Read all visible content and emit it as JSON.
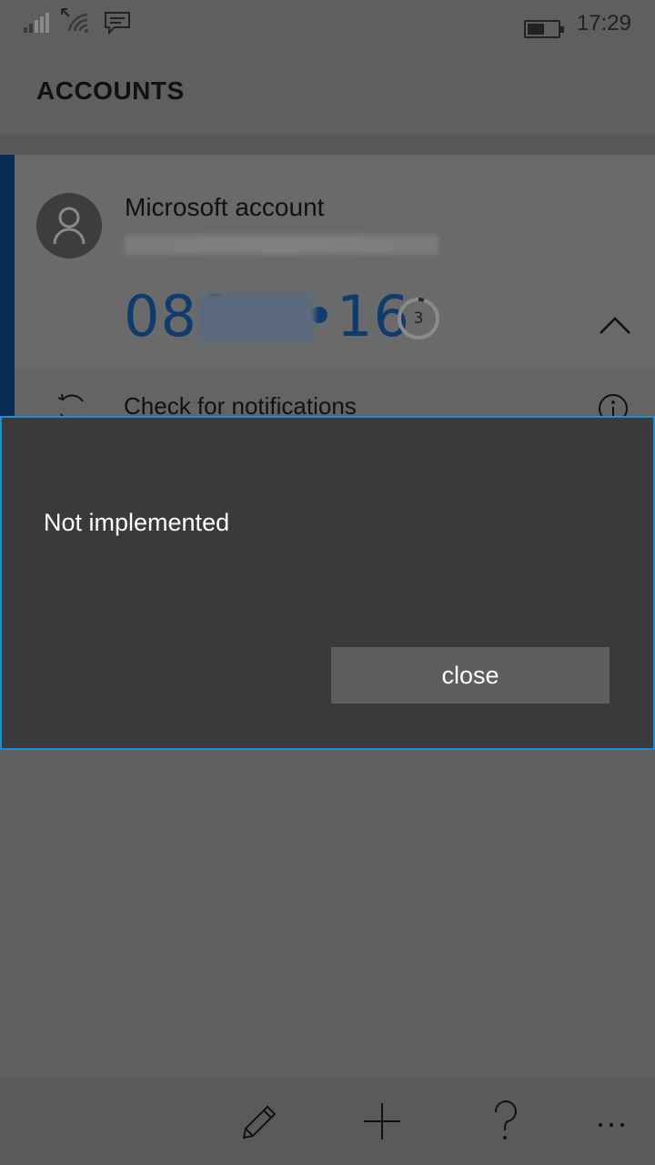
{
  "status_bar": {
    "time": "17:29",
    "icons": [
      "signal-icon",
      "wifi-icon",
      "message-icon",
      "battery-icon"
    ],
    "battery_level": 0.5
  },
  "header": {
    "title": "ACCOUNTS"
  },
  "account": {
    "name": "Microsoft account",
    "email": "•••••••••@•••••••",
    "code": "080•••16",
    "timer_seconds": "3",
    "icons": [
      "avatar-icon",
      "timer-ring-icon",
      "chevron-up-icon"
    ]
  },
  "notification_row": {
    "label": "Check for notifications",
    "icons": [
      "refresh-icon",
      "info-icon"
    ]
  },
  "dialog": {
    "message": "Not implemented",
    "close_label": "close"
  },
  "app_bar": {
    "buttons": [
      "edit-icon",
      "add-icon",
      "help-icon",
      "more-icon"
    ]
  },
  "colors": {
    "accent": "#1b8fd6",
    "code_blue": "#0f3c6d",
    "accent_strip": "#0a2c54",
    "dialog_bg": "#3a3a3a"
  }
}
